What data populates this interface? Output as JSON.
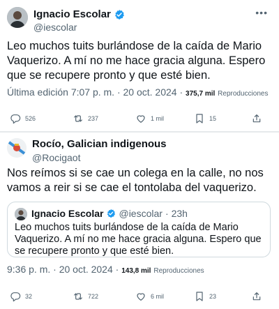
{
  "tweet1": {
    "author_name": "Ignacio Escolar",
    "handle": "@iescolar",
    "more_label": "•••",
    "text": "Leo muchos tuits burlándose de la caída de Mario Vaquerizo. A mí no me hace gracia alguna. Espero que se recupere pronto y que esté bien.",
    "edited_datetime": "Última edición 7:07 p. m. · 20 oct. 2024 ·",
    "views_count": "375,7 mil",
    "views_label": "Reproducciones",
    "actions": {
      "replies": "526",
      "reposts": "237",
      "likes": "1 mil",
      "bookmarks": "15"
    }
  },
  "tweet2": {
    "author_name": "Rocío, Galician indigenous",
    "handle": "@Rocigaot",
    "text": "Nos reímos si se cae un colega en la calle, no nos vamos a reir si se cae el tontolaba del vaquerizo.",
    "quote": {
      "author_name": "Ignacio Escolar",
      "handle": "@iescolar",
      "separator": "·",
      "time": "23h",
      "text": "Leo muchos tuits burlándose de la caída de Mario Vaquerizo. A mí no me hace gracia alguna. Espero que se recupere pronto y que esté bien."
    },
    "datetime": "9:36 p. m. · 20 oct. 2024 ·",
    "views_count": "143,8 mil",
    "views_label": "Reproducciones",
    "actions": {
      "replies": "32",
      "reposts": "722",
      "likes": "6 mil",
      "bookmarks": "23"
    }
  },
  "colors": {
    "verified": "#1d9bf0",
    "secondary_text": "#536471",
    "primary_text": "#0f1419"
  }
}
